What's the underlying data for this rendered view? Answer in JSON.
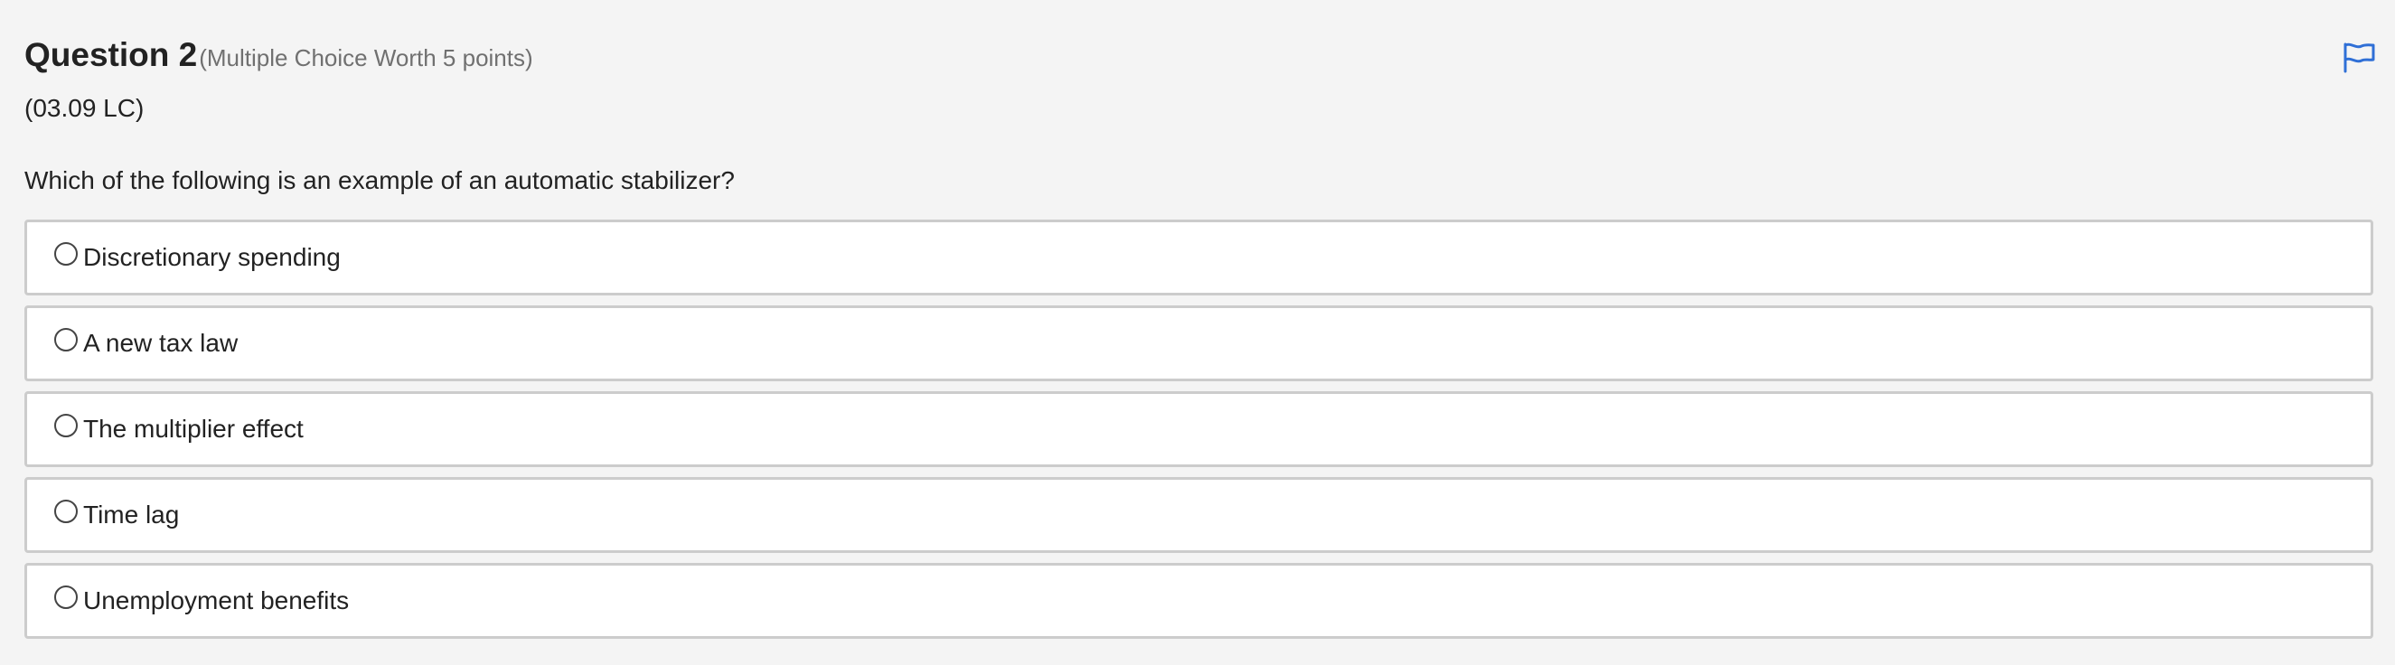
{
  "question": {
    "title": "Question 2",
    "meta": "(Multiple Choice Worth 5 points)",
    "code": "(03.09 LC)",
    "prompt": "Which of the following is an example of an automatic stabilizer?",
    "flag_icon": "flag-icon",
    "accent_color": "#2f6fd6"
  },
  "options": [
    {
      "label": "Discretionary spending",
      "selected": false
    },
    {
      "label": "A new tax law",
      "selected": false
    },
    {
      "label": "The multiplier effect",
      "selected": false
    },
    {
      "label": "Time lag",
      "selected": false
    },
    {
      "label": "Unemployment benefits",
      "selected": false
    }
  ]
}
